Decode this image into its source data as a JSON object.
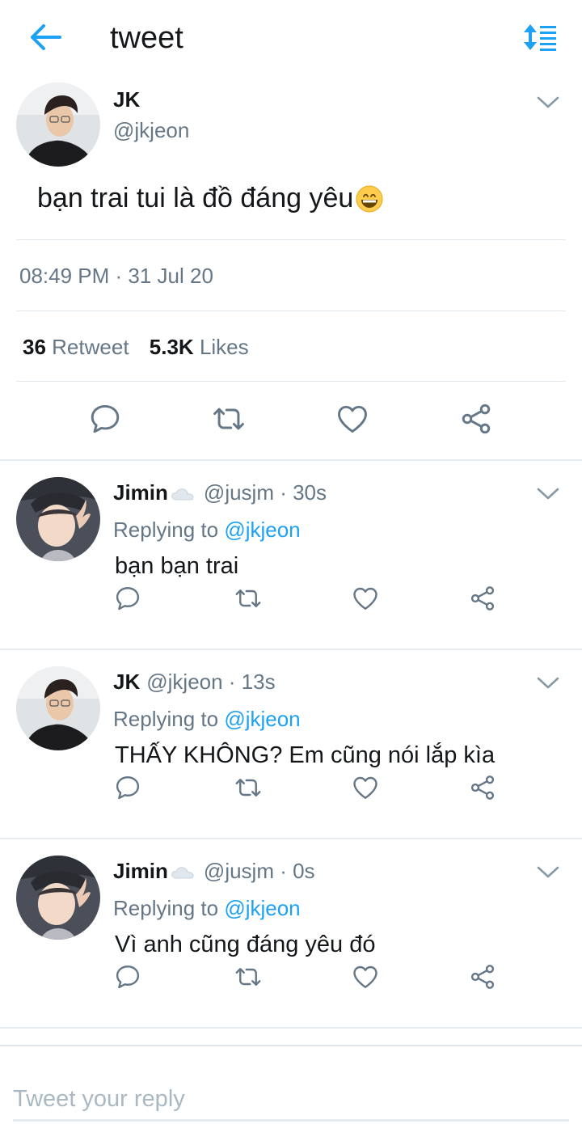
{
  "header": {
    "title": "tweet",
    "back_icon": "back-arrow-icon",
    "sort_icon": "sort-icon",
    "accent_color": "#1da1f2"
  },
  "main_tweet": {
    "name": "JK",
    "handle": "@jkjeon",
    "text": "bạn trai tui là đồ đáng yêu",
    "emoji": "grinning-face-emoji",
    "timestamp": "08:49 PM · 31 Jul 20",
    "retweets_count": "36",
    "retweets_label": "Retweet",
    "likes_count": "5.3K",
    "likes_label": "Likes"
  },
  "replies": [
    {
      "name": "Jimin",
      "badge_icon": "cloud-icon",
      "meta": "@jusjm · 30s",
      "replying_label": "Replying to",
      "replying_to": "@jkjeon",
      "text": "bạn bạn trai"
    },
    {
      "name": "JK",
      "meta": "@jkjeon · 13s",
      "replying_label": "Replying to",
      "replying_to": "@jkjeon",
      "text": "THẤY KHÔNG? Em cũng nói lắp kìa"
    },
    {
      "name": "Jimin",
      "badge_icon": "cloud-icon",
      "meta": "@jusjm · 0s",
      "replying_label": "Replying to",
      "replying_to": "@jkjeon",
      "text": "Vì anh cũng đáng yêu đó"
    }
  ],
  "compose": {
    "placeholder": "Tweet your reply"
  }
}
